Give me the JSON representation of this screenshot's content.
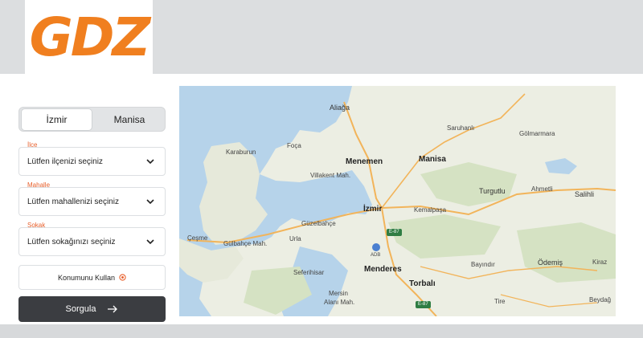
{
  "brand": {
    "logo_text": "GDZ",
    "color": "#f07f1f"
  },
  "city_toggle": {
    "active": "İzmir",
    "inactive": "Manisa"
  },
  "form": {
    "district": {
      "label": "İlçe",
      "placeholder": "Lütfen ilçenizi seçiniz"
    },
    "neighborhood": {
      "label": "Mahalle",
      "placeholder": "Lütfen mahallenizi seçiniz"
    },
    "street": {
      "label": "Sokak",
      "placeholder": "Lütfen sokağınızı seçiniz"
    },
    "use_location_label": "Konumunu Kullan",
    "query_label": "Sorgula",
    "accent_color": "#e8602c"
  },
  "map": {
    "labels": {
      "aliaga": "Aliağa",
      "saruhanli": "Saruhanlı",
      "golmarmara": "Gölmarmara",
      "karaburun": "Karaburun",
      "foca": "Foça",
      "menemen": "Menemen",
      "manisa": "Manisa",
      "villakent": "Villakent Mah.",
      "turgutlu": "Turgutlu",
      "ahmetli": "Ahmetli",
      "salihli": "Salihli",
      "izmir": "İzmir",
      "kemalpasa": "Kemalpaşa",
      "guzelbahce": "Güzelbahçe",
      "cesme": "Çeşme",
      "gulbahce": "Gülbahçe Mah.",
      "urla": "Urla",
      "seferihisar": "Seferihisar",
      "menderes": "Menderes",
      "bayindir": "Bayındır",
      "odemis": "Ödemiş",
      "kiraz": "Kiraz",
      "torbali": "Torbalı",
      "mersin_alani_1": "Mersin",
      "mersin_alani_2": "Alanı Mah.",
      "tire": "Tire",
      "beydag": "Beydağ",
      "adb": "ADB"
    },
    "road_badges": {
      "e87_north": "E-87",
      "e87_south": "E-87"
    }
  }
}
